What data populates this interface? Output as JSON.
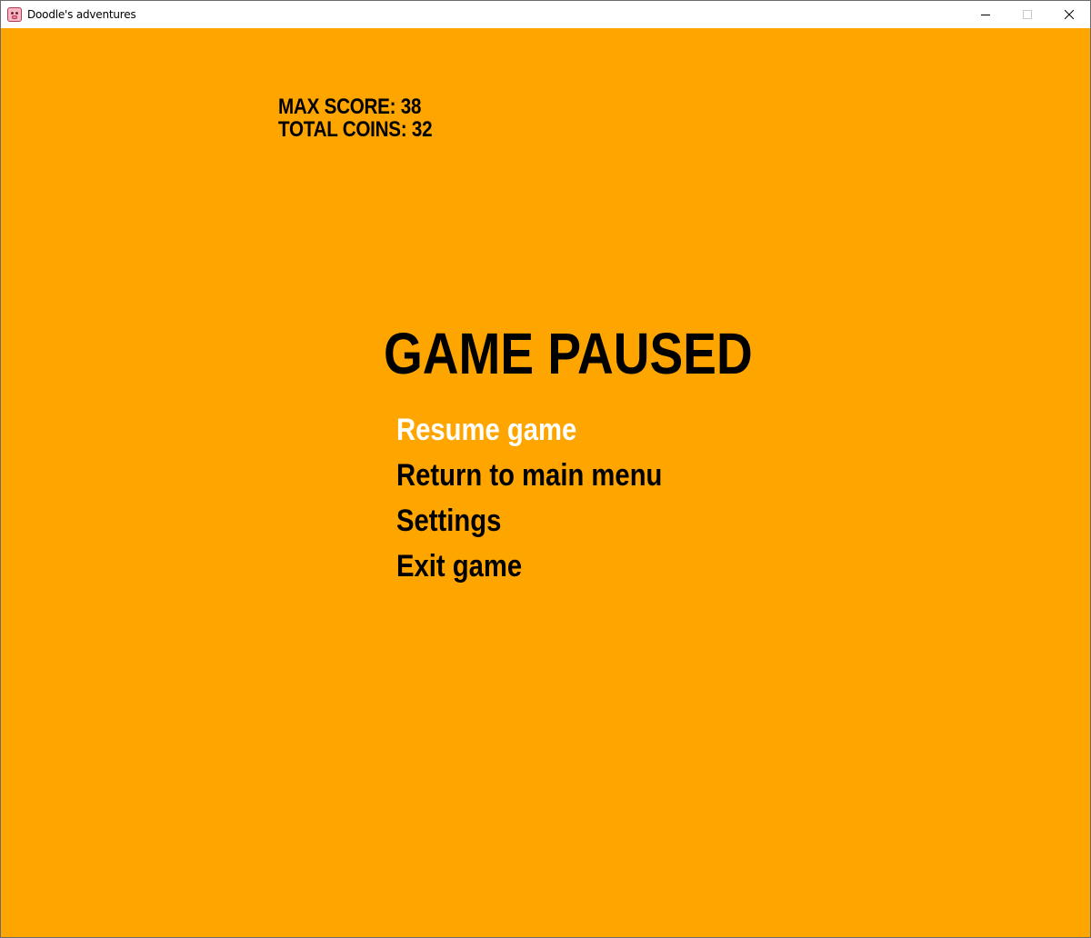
{
  "window": {
    "title": "Doodle's adventures",
    "icon": "pig-face-icon"
  },
  "stats": {
    "max_score": "MAX SCORE: 38",
    "total_coins": "TOTAL COINS: 32"
  },
  "pause_menu": {
    "title": "GAME PAUSED",
    "items": [
      {
        "label": "Resume game",
        "selected": true
      },
      {
        "label": "Return to main menu",
        "selected": false
      },
      {
        "label": "Settings",
        "selected": false
      },
      {
        "label": "Exit game",
        "selected": false
      }
    ]
  },
  "colors": {
    "background": "#ffa500",
    "text": "#000000",
    "selected_text": "#ffffff"
  }
}
